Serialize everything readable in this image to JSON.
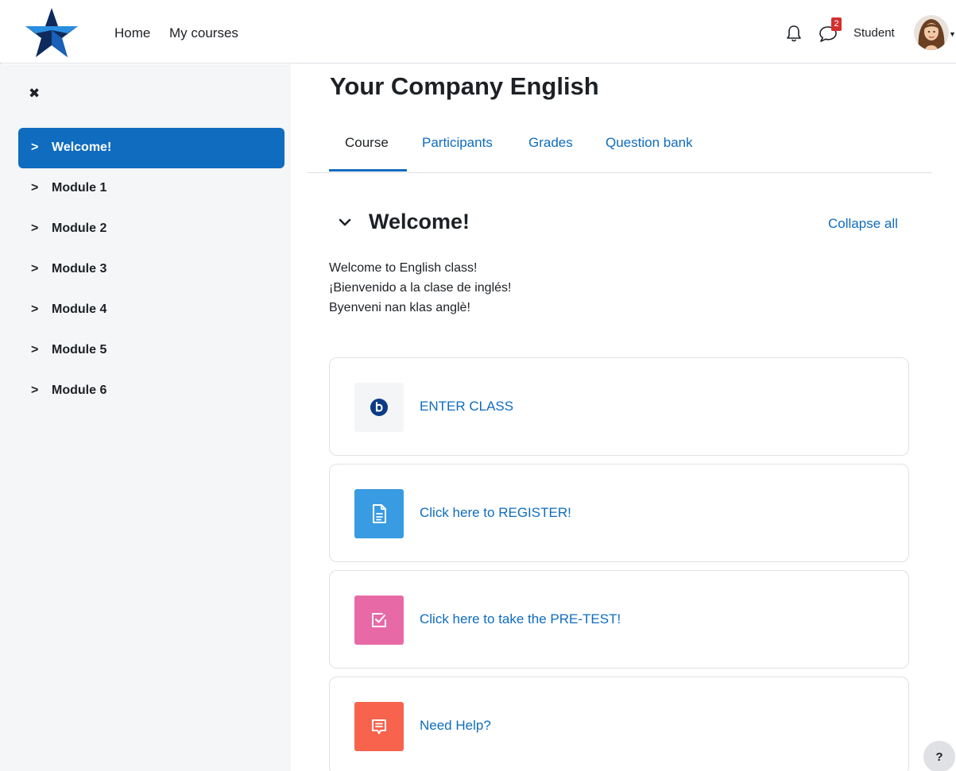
{
  "navbar": {
    "links": [
      "Home",
      "My courses"
    ],
    "notification_count": "2",
    "user_name": "Student"
  },
  "drawer": {
    "close_glyph": "✖",
    "items": [
      {
        "label": "Welcome!",
        "active": true
      },
      {
        "label": "Module 1",
        "active": false
      },
      {
        "label": "Module 2",
        "active": false
      },
      {
        "label": "Module 3",
        "active": false
      },
      {
        "label": "Module 4",
        "active": false
      },
      {
        "label": "Module 5",
        "active": false
      },
      {
        "label": "Module 6",
        "active": false
      }
    ]
  },
  "course": {
    "title": "Your Company English",
    "tabs": [
      "Course",
      "Participants",
      "Grades",
      "Question bank"
    ],
    "active_tab": "Course"
  },
  "section": {
    "title": "Welcome!",
    "collapse_label": "Collapse all",
    "summary": [
      "Welcome to English class!",
      "¡Bienvenido a la clase de inglés!",
      "Byenveni nan klas anglè!"
    ]
  },
  "activities": [
    {
      "label": "ENTER CLASS",
      "icon": "bigbluebutton-icon",
      "color": "#0b3b85"
    },
    {
      "label": "Click here to REGISTER!",
      "icon": "page-icon",
      "color": "#399be2"
    },
    {
      "label": "Click here to take the PRE-TEST!",
      "icon": "quiz-icon",
      "color": "#e76aa7"
    },
    {
      "label": "Need Help?",
      "icon": "forum-icon",
      "color": "#f7634d"
    }
  ],
  "help_button": "?",
  "colors": {
    "accent": "#0f6cbf",
    "drawer_bg": "#f5f6f8"
  }
}
